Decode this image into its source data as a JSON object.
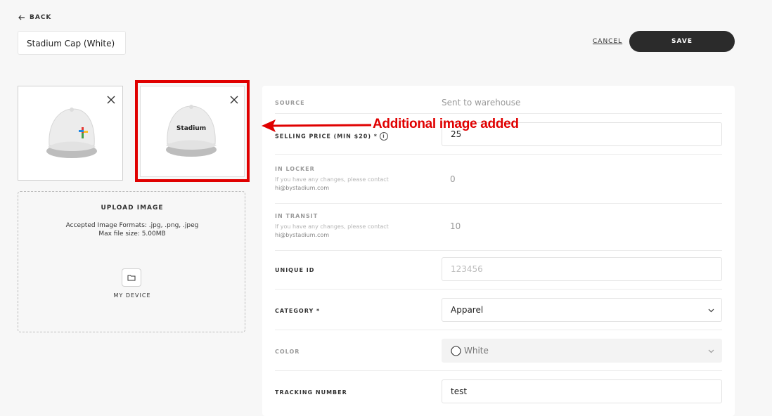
{
  "header": {
    "back_label": "BACK",
    "product_name": "Stadium Cap (White)",
    "cancel_label": "CANCEL",
    "save_label": "SAVE"
  },
  "images": {
    "thumb1_logo_text": "",
    "thumb2_logo_text": "Stadium"
  },
  "upload": {
    "title": "UPLOAD IMAGE",
    "formats": "Accepted Image Formats: .jpg, .png, .jpeg",
    "max_size": "Max file size: 5.00MB",
    "device_label": "MY DEVICE"
  },
  "form": {
    "source_label": "SOURCE",
    "source_value": "Sent to warehouse",
    "price_label": "SELLING PRICE (MIN $20) *",
    "price_value": "25",
    "locker_label": "IN LOCKER",
    "locker_note": "If you have any changes, please contact",
    "locker_email": "hi@bystadium.com",
    "locker_value": "0",
    "transit_label": "IN TRANSIT",
    "transit_note": "If you have any changes, please contact",
    "transit_email": "hi@bystadium.com",
    "transit_value": "10",
    "unique_id_label": "UNIQUE ID",
    "unique_id_placeholder": "123456",
    "category_label": "CATEGORY *",
    "category_value": "Apparel",
    "color_label": "COLOR",
    "color_value": "White",
    "tracking_label": "TRACKING NUMBER",
    "tracking_value": "test"
  },
  "annotation": {
    "text": "Additional image added",
    "color": "#e00000"
  },
  "colors": {
    "primary_button": "#2b2b2b",
    "background": "#f7f7f7",
    "annotation_red": "#e00000"
  }
}
